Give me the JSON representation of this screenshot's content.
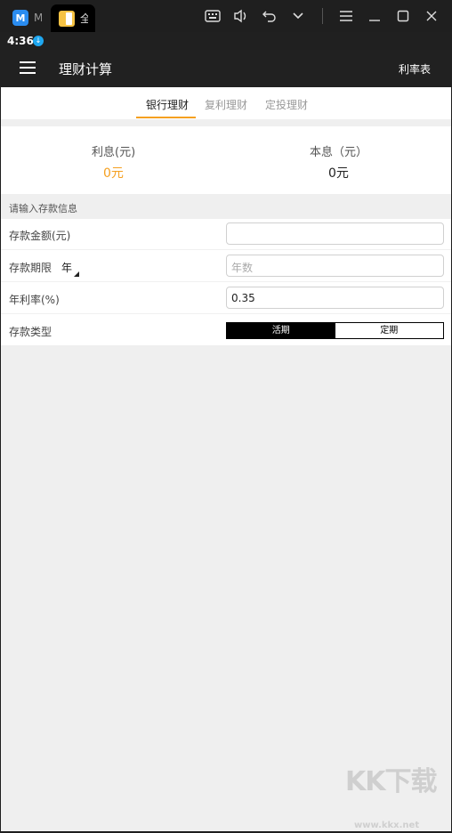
{
  "emulator": {
    "tab1_text": "M",
    "tab2_text": "全",
    "toolbar_icons": [
      "keyboard-icon",
      "volume-icon",
      "undo-icon",
      "chevron-down-icon",
      "menu-icon",
      "minimize-icon",
      "maximize-icon",
      "close-icon"
    ]
  },
  "status_bar": {
    "time": "4:36"
  },
  "app_bar": {
    "title": "理财计算",
    "action": "利率表"
  },
  "tabs": [
    {
      "label": "银行理财",
      "active": true
    },
    {
      "label": "复利理财",
      "active": false
    },
    {
      "label": "定投理财",
      "active": false
    }
  ],
  "result": {
    "interest_label": "利息(元)",
    "interest_value": "0元",
    "total_label": "本息（元）",
    "total_value": "0元",
    "accent": "#f5a020"
  },
  "form": {
    "section_title": "请输入存款信息",
    "amount_label": "存款金额(元)",
    "amount_value": "",
    "term_label": "存款期限",
    "term_unit": "年",
    "term_placeholder": "年数",
    "rate_label": "年利率(%)",
    "rate_value": "0.35",
    "type_label": "存款类型",
    "type_options": [
      "活期",
      "定期"
    ],
    "type_selected": "活期"
  },
  "watermark": {
    "text": "KK下载",
    "url": "www.kkx.net"
  }
}
